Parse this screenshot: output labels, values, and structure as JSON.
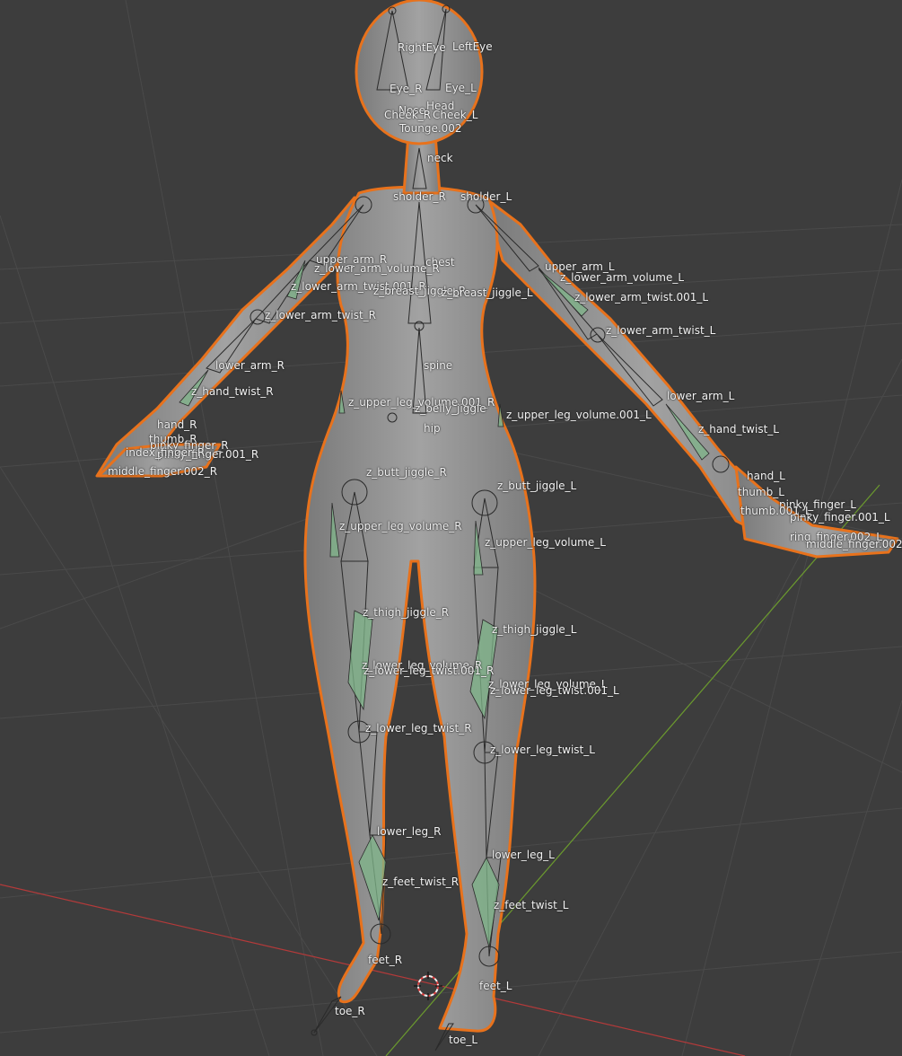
{
  "app": "Blender 3D Viewport",
  "colors": {
    "background": "#3d3d3d",
    "grid": "#4a4a4a",
    "axis_x": "#b33a3a",
    "axis_y": "#6b9a2e",
    "mesh": "#8f8f8f",
    "outline": "#e8721c",
    "bone_highlight": "#7fb58a",
    "label": "#f2f2f2"
  },
  "cursor_icon": "3d-cursor-icon",
  "bones": [
    "RightEye",
    "LeftEye",
    "Eye_R",
    "Eye_L",
    "Head",
    "Nose",
    "Cheek_R",
    "Cheek_L",
    "Tounge.002",
    "neck",
    "sholder_R",
    "sholder_L",
    "upper_arm_R",
    "chest",
    "z_lower_arm_volume_R",
    "z_lower_arm_twist.001_R",
    "z_breast_jiggle_R",
    "z_breast_jiggle_L",
    "upper_arm_L",
    "z_lower_arm_volume_L",
    "z_lower_arm_twist.001_L",
    "z_lower_arm_twist_R",
    "z_lower_arm_twist_L",
    "spine",
    "lower_arm_R",
    "z_hand_twist_R",
    "lower_arm_L",
    "z_upper_leg_volume.001_R",
    "z_belly_jiggle",
    "z_upper_leg_volume.001_L",
    "hip",
    "z_hand_twist_L",
    "hand_R",
    "thumb_R",
    "pinky_finger_R",
    "pinky_finger.001_R",
    "index_finger_R",
    "middle_finger.002_R",
    "z_butt_jiggle_R",
    "hand_L",
    "z_butt_jiggle_L",
    "thumb_L",
    "pinky_finger_L",
    "pinky_finger.001_L",
    "thumb.001_L",
    "ring_finger.002_L",
    "middle_finger.002_L",
    "z_upper_leg_volume_R",
    "z_upper_leg_volume_L",
    "z_thigh_jiggle_R",
    "z_thigh_jiggle_L",
    "z_lower_leg_volume_R",
    "z_lower_leg_twist.001_R",
    "z_lower_leg_volume_L",
    "z_lower_leg_twist.001_L",
    "z_lower_leg_twist_R",
    "z_lower_leg_twist_L",
    "lower_leg_R",
    "lower_leg_L",
    "z_feet_twist_R",
    "z_feet_twist_L",
    "feet_R",
    "feet_L",
    "toe_R",
    "toe_L"
  ]
}
